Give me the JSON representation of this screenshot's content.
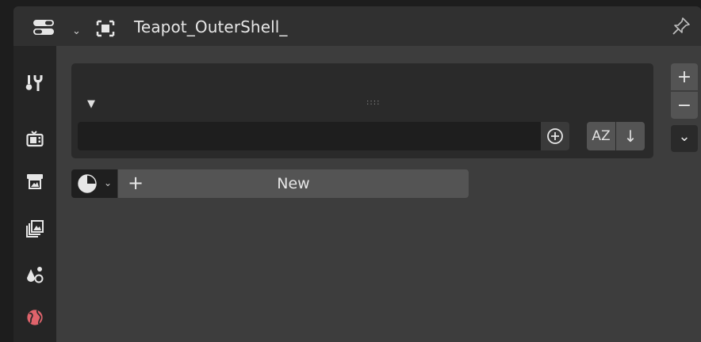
{
  "header": {
    "object_name": "Teapot_OuterShell_"
  },
  "tabs": [
    {
      "name": "tool-tab",
      "icon": "tool-icon"
    },
    {
      "name": "render-tab",
      "icon": "render-icon"
    },
    {
      "name": "output-tab",
      "icon": "output-icon"
    },
    {
      "name": "view-layer-tab",
      "icon": "view-layer-icon"
    },
    {
      "name": "scene-tab",
      "icon": "scene-icon"
    },
    {
      "name": "world-tab",
      "icon": "world-icon",
      "color": "#e0636b"
    }
  ],
  "material_slots": {
    "expand_glyph": "▼",
    "grip_glyph": "::::",
    "filter_value": "",
    "sort_alpha_label": "AZ",
    "sort_direction_glyph": "↓",
    "add_slot_glyph": "+",
    "remove_slot_glyph": "−",
    "specials_glyph": "⌄"
  },
  "material_browser": {
    "new_plus_glyph": "+",
    "new_label": "New"
  },
  "colors": {
    "background": "#1d1d1d",
    "header": "#303030",
    "panel": "#3d3d3d",
    "button": "#545454",
    "accent_world": "#e0636b"
  }
}
